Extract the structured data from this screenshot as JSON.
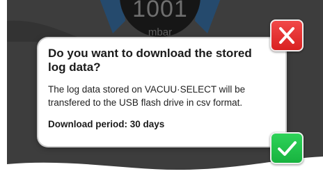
{
  "gauge": {
    "value": "1001",
    "unit": "mbar"
  },
  "dialog": {
    "title": "Do you want to download the stored log data?",
    "body": "The log data stored on VACUU·SELECT will be transfered to the USB flash drive in csv format.",
    "period": "Download period: 30 days"
  },
  "buttons": {
    "cancel_icon": "close-icon",
    "confirm_icon": "check-icon"
  },
  "colors": {
    "cancel": "#e52e2e",
    "confirm": "#22c24c",
    "backdrop": "#3c3c3c"
  }
}
